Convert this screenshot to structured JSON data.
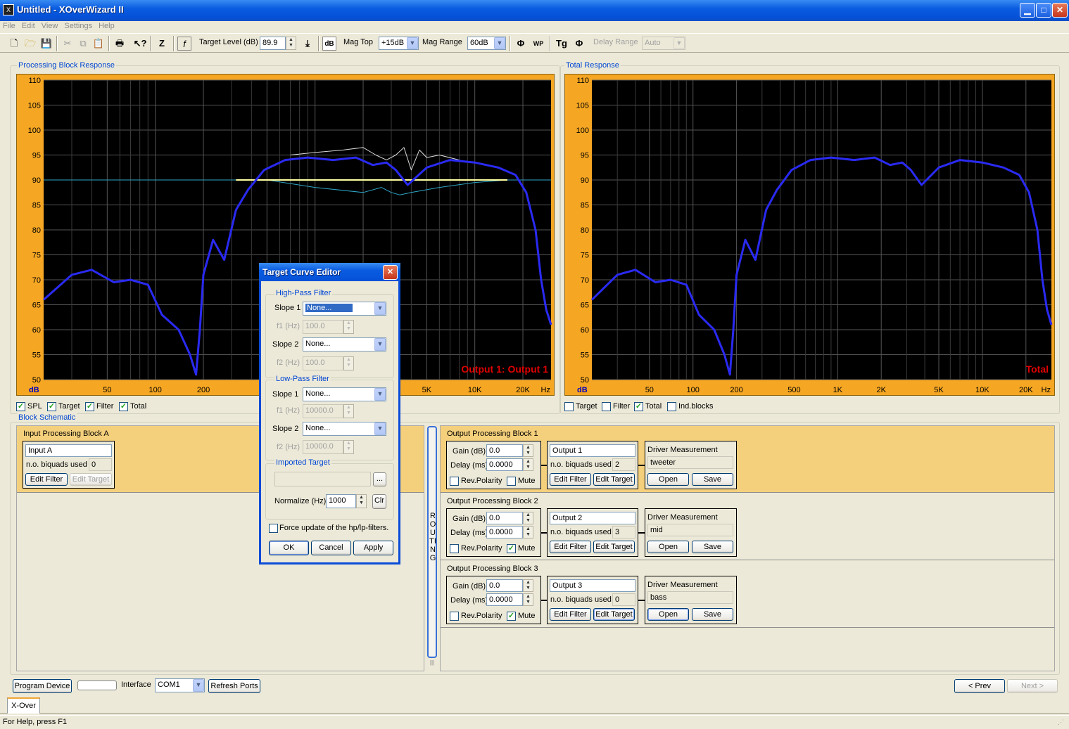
{
  "window": {
    "app_icon": "X",
    "title": "Untitled - XOverWizard II"
  },
  "menu": [
    "File",
    "Edit",
    "View",
    "Settings",
    "Help"
  ],
  "toolbar": {
    "target_level_label": "Target Level (dB)",
    "target_level_value": "89.9",
    "db_label": "dB",
    "mag_top_label": "Mag Top",
    "mag_top_value": "+15dB",
    "mag_range_label": "Mag Range",
    "mag_range_value": "60dB",
    "delay_range_label": "Delay Range",
    "delay_range_value": "Auto"
  },
  "processing_panel": {
    "title": "Processing Block Response",
    "overlay_label": "Output 1: Output 1",
    "checks": [
      {
        "label": "SPL",
        "checked": true
      },
      {
        "label": "Target",
        "checked": true
      },
      {
        "label": "Filter",
        "checked": true
      },
      {
        "label": "Total",
        "checked": true
      }
    ]
  },
  "total_panel": {
    "title": "Total Response",
    "overlay_label": "Total",
    "checks": [
      {
        "label": "Target",
        "checked": false
      },
      {
        "label": "Filter",
        "checked": false
      },
      {
        "label": "Total",
        "checked": true
      },
      {
        "label": "Ind.blocks",
        "checked": false
      }
    ]
  },
  "chart_axes": {
    "y_unit": "dB",
    "x_unit": "Hz",
    "y_ticks": [
      "110",
      "105",
      "100",
      "95",
      "90",
      "85",
      "80",
      "75",
      "70",
      "65",
      "60",
      "55",
      "50"
    ],
    "x_ticks": [
      "50",
      "100",
      "200",
      "500",
      "1K",
      "2K",
      "5K",
      "10K",
      "20K"
    ]
  },
  "chart_data": [
    {
      "type": "line",
      "title": "Processing Block Response",
      "xlabel": "Hz",
      "ylabel": "dB",
      "xlim": [
        20,
        30000
      ],
      "ylim": [
        50,
        110
      ],
      "x_scale": "log",
      "grid": true,
      "series": [
        {
          "name": "SPL",
          "color": "#2a2af2",
          "x": [
            20,
            30,
            40,
            55,
            70,
            90,
            110,
            140,
            165,
            180,
            190,
            200,
            230,
            270,
            320,
            380,
            480,
            650,
            900,
            1300,
            1800,
            2300,
            2800,
            3200,
            3800,
            5000,
            7000,
            10000,
            14000,
            18000,
            21000,
            24000,
            26000,
            28000,
            30000
          ],
          "y": [
            66,
            71,
            72,
            69.5,
            70,
            69,
            63,
            60,
            55,
            51,
            60,
            71,
            78,
            74,
            84,
            88,
            92,
            94,
            94.5,
            94,
            94.5,
            93,
            93.5,
            92,
            89,
            92.5,
            94,
            93.5,
            92.5,
            91,
            87.5,
            80,
            70,
            64,
            61
          ]
        },
        {
          "name": "Target",
          "color": "#ffffa0",
          "x": [
            320,
            16000
          ],
          "y": [
            90,
            90
          ]
        },
        {
          "name": "Filter",
          "color": "#2fa6c8",
          "x": [
            20,
            500,
            1000,
            2000,
            2600,
            3000,
            3400,
            4000,
            6000,
            10000,
            16000,
            30000
          ],
          "y": [
            90,
            90,
            88.5,
            87.5,
            88.5,
            87.5,
            87,
            87.5,
            88.5,
            89.5,
            90,
            90
          ]
        },
        {
          "name": "Total",
          "color": "#d8d8d8",
          "x": [
            700,
            1000,
            1500,
            2000,
            2400,
            2800,
            3200,
            3600,
            4000,
            4500,
            5000,
            6000,
            8000
          ],
          "y": [
            95,
            95.5,
            96,
            96.5,
            95,
            94,
            95,
            96.5,
            92,
            96,
            94.5,
            95,
            94
          ]
        }
      ]
    },
    {
      "type": "line",
      "title": "Total Response",
      "xlabel": "Hz",
      "ylabel": "dB",
      "xlim": [
        20,
        30000
      ],
      "ylim": [
        50,
        110
      ],
      "x_scale": "log",
      "grid": true,
      "series": [
        {
          "name": "Total",
          "color": "#2a2af2",
          "x": [
            20,
            30,
            40,
            55,
            70,
            90,
            110,
            140,
            165,
            180,
            190,
            200,
            230,
            270,
            320,
            380,
            480,
            650,
            900,
            1300,
            1800,
            2300,
            2800,
            3200,
            3800,
            5000,
            7000,
            10000,
            14000,
            18000,
            21000,
            24000,
            26000,
            28000,
            30000
          ],
          "y": [
            66,
            71,
            72,
            69.5,
            70,
            69,
            63,
            60,
            55,
            51,
            60,
            71,
            78,
            74,
            84,
            88,
            92,
            94,
            94.5,
            94,
            94.5,
            93,
            93.5,
            92,
            89,
            92.5,
            94,
            93.5,
            92.5,
            91,
            87.5,
            80,
            70,
            64,
            61
          ]
        }
      ]
    }
  ],
  "schematic": {
    "title": "Block Schematic",
    "input_block": {
      "title": "Input Processing Block A",
      "name": "Input A",
      "biquads_label": "n.o. biquads used",
      "biquads": "0",
      "edit_filter": "Edit Filter",
      "edit_target": "Edit Target"
    },
    "routing_label": "ROUTING",
    "labels": {
      "gain": "Gain (dB)",
      "delay": "Delay (ms)",
      "rev": "Rev.Polarity",
      "mute": "Mute",
      "biquads": "n.o. biquads used",
      "edit_filter": "Edit Filter",
      "edit_target": "Edit Target",
      "driver": "Driver Measurement",
      "open": "Open",
      "save": "Save"
    },
    "outputs": [
      {
        "title": "Output Processing Block 1",
        "gain": "0.0",
        "delay": "0.0000",
        "rev": false,
        "mute": false,
        "name": "Output 1",
        "biquads": "2",
        "driver": "tweeter"
      },
      {
        "title": "Output Processing Block 2",
        "gain": "0.0",
        "delay": "0.0000",
        "rev": false,
        "mute": true,
        "name": "Output 2",
        "biquads": "3",
        "driver": "mid"
      },
      {
        "title": "Output Processing Block 3",
        "gain": "0.0",
        "delay": "0.0000",
        "rev": false,
        "mute": true,
        "name": "Output 3",
        "biquads": "0",
        "driver": "bass"
      }
    ]
  },
  "bottom": {
    "program": "Program Device",
    "interface_label": "Interface",
    "interface_value": "COM1",
    "refresh": "Refresh Ports",
    "prev": "< Prev",
    "next": "Next >"
  },
  "tab": "X-Over",
  "status": "For Help, press F1",
  "dialog": {
    "title": "Target Curve Editor",
    "hp_group": "High-Pass Filter",
    "lp_group": "Low-Pass Filter",
    "imported_group": "Imported Target",
    "slope1_label": "Slope 1",
    "slope2_label": "Slope 2",
    "f1_label": "f1 (Hz)",
    "f2_label": "f2 (Hz)",
    "hp_slope1": "None...",
    "hp_slope2": "None...",
    "hp_f1": "100.0",
    "hp_f2": "100.0",
    "lp_slope1": "None...",
    "lp_slope2": "None...",
    "lp_f1": "10000.0",
    "lp_f2": "10000.0",
    "browse": "...",
    "normalize_label": "Normalize (Hz)",
    "normalize_value": "1000",
    "clr": "Clr",
    "force_label": "Force update of the hp/lp-filters.",
    "ok": "OK",
    "cancel": "Cancel",
    "apply": "Apply"
  }
}
